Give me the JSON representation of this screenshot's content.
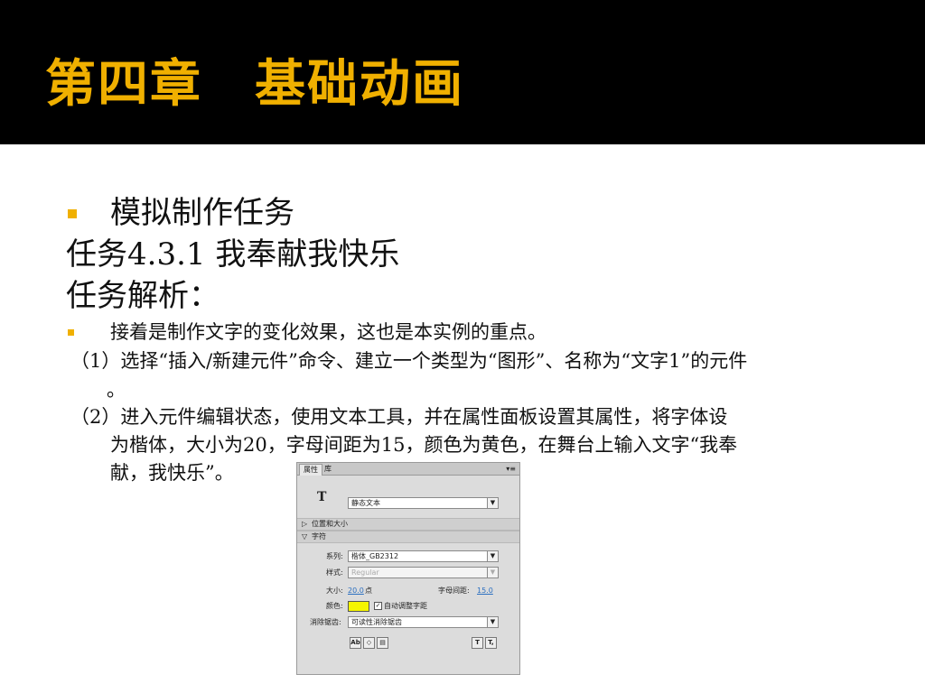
{
  "slide": {
    "title": "第四章　基础动画",
    "line1": "模拟制作任务",
    "line2": "任务4.3.1 我奉献我快乐",
    "line3": "任务解析：",
    "line4": "接着是制作文字的变化效果，这也是本实例的重点。",
    "line5": "（1）选择“插入/新建元件”命令、建立一个类型为“图形”、名称为“文字1”的元件",
    "line5b": "。",
    "line6a": "（2）进入元件编辑状态，使用文本工具，并在属性面板设置其属性，将字体设",
    "line6b": "为楷体，大小为20，字母间距为15，颜色为黄色，在舞台上输入文字“我奉",
    "line6c": "献，我快乐”。",
    "bullet_color": "#f0b000"
  },
  "panel": {
    "tab_properties": "属性",
    "tab_library": "库",
    "menu_icon": "▾≡",
    "tool_glyph": "T",
    "text_type": "静态文本",
    "section_position": "位置和大小",
    "section_character": "字符",
    "family_label": "系列:",
    "family_value": "楷体_GB2312",
    "style_label": "样式:",
    "style_value": "Regular",
    "size_label": "大小:",
    "size_value": "20.0",
    "size_unit": "点",
    "spacing_label": "字母间距:",
    "spacing_value": "15.0",
    "color_label": "颜色:",
    "color_value": "#f5f500",
    "autokern_label": "自动调整字距",
    "antialias_label": "消除锯齿:",
    "antialias_value": "可读性消除锯齿"
  }
}
